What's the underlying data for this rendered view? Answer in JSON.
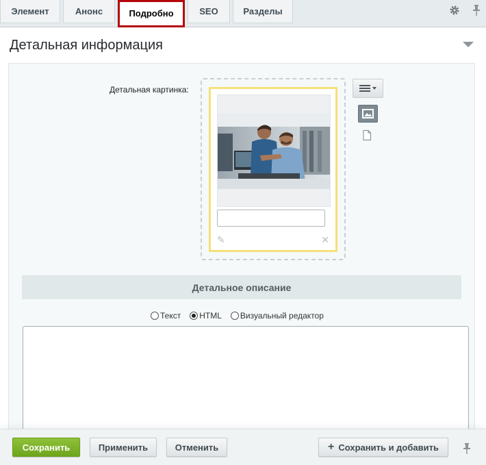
{
  "tabs": [
    {
      "label": "Элемент"
    },
    {
      "label": "Анонс"
    },
    {
      "label": "Подробно",
      "active": true
    },
    {
      "label": "SEO"
    },
    {
      "label": "Разделы"
    }
  ],
  "toolbar_icons": [
    "gear-icon",
    "pin-icon"
  ],
  "section": {
    "title": "Детальная информация"
  },
  "detail_image": {
    "label": "Детальная картинка:",
    "description_value": ""
  },
  "description": {
    "header": "Детальное описание",
    "editor_modes": [
      {
        "label": "Текст",
        "selected": false
      },
      {
        "label": "HTML",
        "selected": true
      },
      {
        "label": "Визуальный редактор",
        "selected": false
      }
    ],
    "content": ""
  },
  "footer": {
    "save_label": "Сохранить",
    "apply_label": "Применить",
    "cancel_label": "Отменить",
    "save_add_label": "Сохранить и добавить"
  },
  "colors": {
    "accent_green": "#7ab32a",
    "active_tab_outline": "#b5060b",
    "image_card_border": "#f5e07a"
  }
}
